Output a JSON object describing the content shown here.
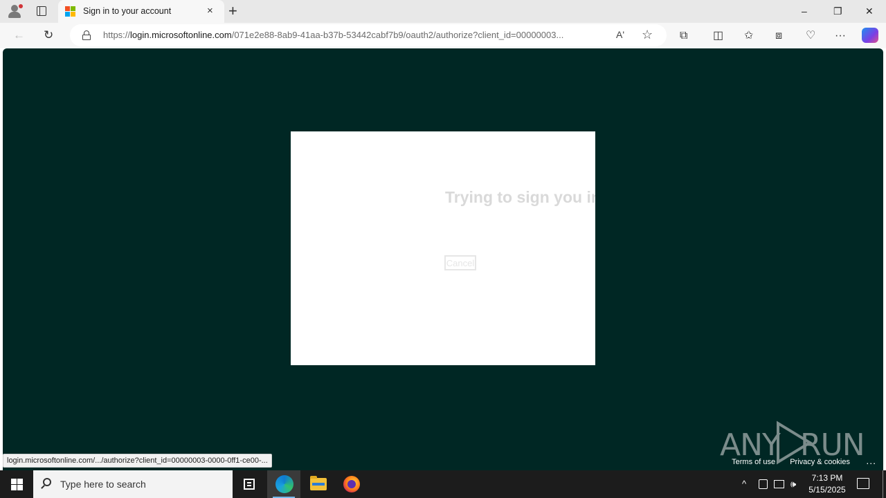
{
  "browser": {
    "tab": {
      "title": "Sign in to your account",
      "close_glyph": "×"
    },
    "new_tab_glyph": "+",
    "window_controls": {
      "minimize": "–",
      "restore": "❐",
      "close": "✕"
    },
    "nav": {
      "back_glyph": "←",
      "refresh_glyph": "↻"
    },
    "address": {
      "prefix": "https://",
      "host": "login.microsoftonline.com",
      "path": "/071e2e88-8ab9-41aa-b37b-53442cabf7b9/oauth2/authorize?client_id=00000003..."
    },
    "read_aloud_glyph": "Aʹ",
    "favorite_glyph": "☆",
    "toolbar_icons": {
      "extensions": "extensions-icon",
      "split_screen": "split-screen-icon",
      "favorites": "favorites-icon",
      "collections": "collections-icon",
      "browser_essentials": "browser-essentials-icon",
      "more": "more-icon",
      "copilot": "copilot-icon"
    },
    "toolbar_glyphs": {
      "extensions": "⧉",
      "split_screen": "◫",
      "favorites": "✩",
      "collections": "⧈",
      "browser_essentials": "♡",
      "more": "···"
    }
  },
  "page": {
    "message": "Trying to sign you in",
    "cancel_label": "Cancel",
    "footer": {
      "terms": "Terms of use",
      "privacy": "Privacy & cookies",
      "more": "..."
    },
    "watermark": "ANY RUN"
  },
  "status_bar": {
    "url": "login.microsoftonline.com/.../authorize?client_id=00000003-0000-0ff1-ce00-..."
  },
  "taskbar": {
    "search_placeholder": "Type here to search",
    "tray": {
      "chevron": "^",
      "volume": "🕪"
    },
    "clock": {
      "time": "7:13 PM",
      "date": "5/15/2025"
    }
  },
  "colors": {
    "page_background": "#002724",
    "card_background": "#ffffff",
    "taskbar": "#1c1c1c",
    "accent": "#0f7bd1"
  }
}
